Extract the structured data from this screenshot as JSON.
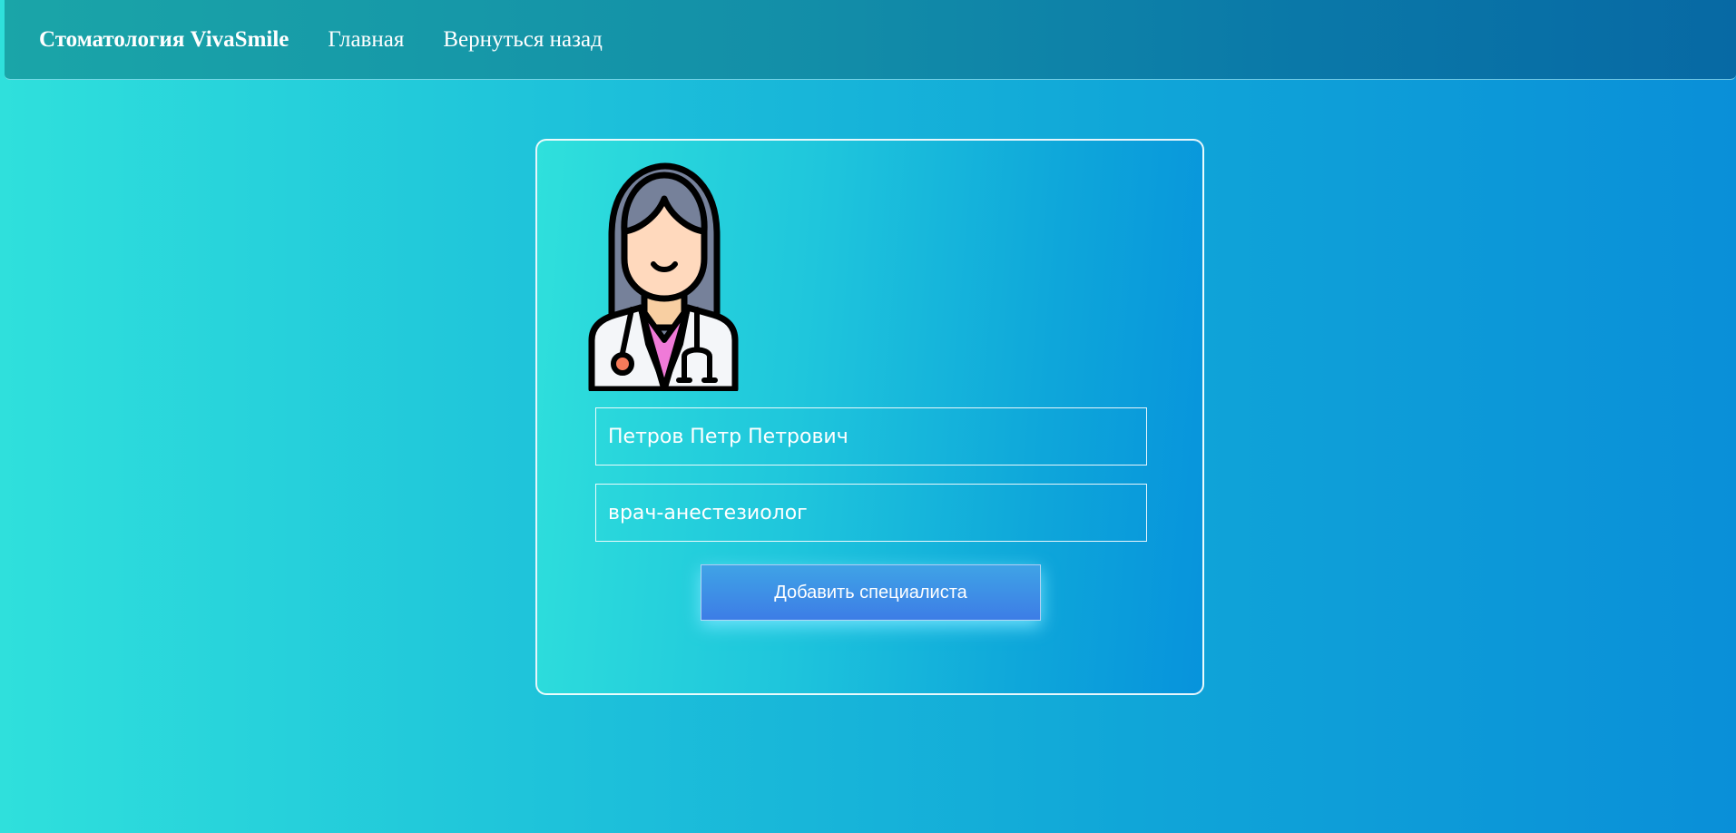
{
  "navbar": {
    "brand": "Стоматология VivaSmile",
    "home_label": "Главная",
    "back_label": "Вернуться назад"
  },
  "form": {
    "avatar_icon": "female-doctor-icon",
    "name_value": "Петров Петр Петрович",
    "specialty_value": "врач-анестезиолог",
    "submit_label": "Добавить специалиста"
  },
  "colors": {
    "background_start": "#2fe0dc",
    "background_end": "#0a8fd8",
    "navbar": "#138fa8",
    "button": "#3d7de6"
  }
}
